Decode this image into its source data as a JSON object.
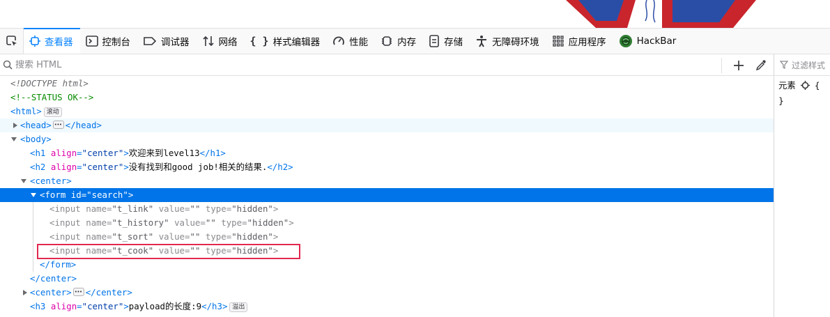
{
  "toolbar": {
    "tabs": [
      {
        "label": "查看器",
        "icon": "inspector-icon",
        "selected": true
      },
      {
        "label": "控制台",
        "icon": "console-icon"
      },
      {
        "label": "调试器",
        "icon": "debugger-icon"
      },
      {
        "label": "网络",
        "icon": "network-icon"
      },
      {
        "label": "样式编辑器",
        "icon": "style-editor-icon"
      },
      {
        "label": "性能",
        "icon": "performance-icon"
      },
      {
        "label": "内存",
        "icon": "memory-icon"
      },
      {
        "label": "存储",
        "icon": "storage-icon"
      },
      {
        "label": "无障碍环境",
        "icon": "accessibility-icon"
      },
      {
        "label": "应用程序",
        "icon": "application-icon"
      },
      {
        "label": "HackBar",
        "icon": "hackbar-icon"
      }
    ]
  },
  "search": {
    "placeholder": "搜索 HTML"
  },
  "rules": {
    "filter_placeholder": "过滤样式",
    "element_label": "元素",
    "open_brace": "{",
    "close_brace": "}"
  },
  "tree": {
    "doctype": "<!DOCTYPE html>",
    "comment": "<!--STATUS OK-->",
    "html_open": "<html>",
    "badge_scroll": "滚动",
    "head_open": "<head>",
    "head_close": "</head>",
    "body_open": "<body>",
    "h1": {
      "open": "<h1",
      "attr": "align",
      "val": "\"center\"",
      "text": "欢迎来到level13",
      "close": "</h1>"
    },
    "h2": {
      "open": "<h2",
      "attr": "align",
      "val": "\"center\"",
      "text": "没有找到和good job!相关的结果.",
      "close": "</h2>"
    },
    "center_open": "<center>",
    "form": {
      "open": "<form",
      "attr": "id",
      "val": "\"search\""
    },
    "inputs": [
      {
        "name": "\"t_link\"",
        "value": "\"\"",
        "type": "\"hidden\""
      },
      {
        "name": "\"t_history\"",
        "value": "\"\"",
        "type": "\"hidden\""
      },
      {
        "name": "\"t_sort\"",
        "value": "\"\"",
        "type": "\"hidden\""
      },
      {
        "name": "\"t_cook\"",
        "value": "\"\"",
        "type": "\"hidden\""
      }
    ],
    "input_tag": "<input",
    "attr_name": "name",
    "attr_value": "value",
    "attr_type": "type",
    "form_close": "</form>",
    "center_close": "</center>",
    "center2_open": "<center>",
    "center2_close": "</center>",
    "h3": {
      "open": "<h3",
      "attr": "align",
      "val": "\"center\"",
      "text": "payload的长度:9",
      "close": "</h3>"
    },
    "badge_overflow": "溢出"
  }
}
